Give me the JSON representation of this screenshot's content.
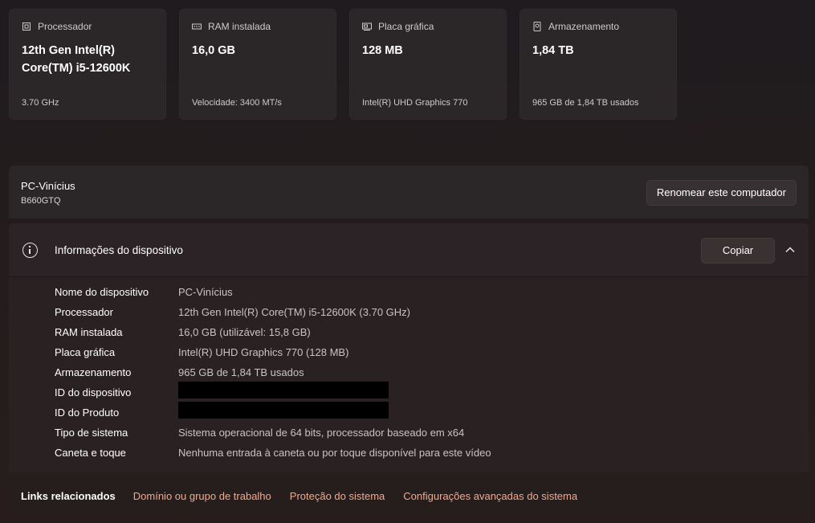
{
  "cards": [
    {
      "label": "Processador",
      "icon": "processor-icon",
      "value": "12th Gen Intel(R) Core(TM) i5-12600K",
      "sub": "3.70 GHz"
    },
    {
      "label": "RAM instalada",
      "icon": "ram-icon",
      "value": "16,0 GB",
      "sub": "Velocidade: 3400 MT/s"
    },
    {
      "label": "Placa gráfica",
      "icon": "graphics-card-icon",
      "value": "128 MB",
      "sub": "Intel(R) UHD Graphics 770"
    },
    {
      "label": "Armazenamento",
      "icon": "storage-icon",
      "value": "1,84 TB",
      "sub": "965 GB de 1,84 TB usados"
    }
  ],
  "pc": {
    "name": "PC-Vinícius",
    "model": "B660GTQ",
    "rename_label": "Renomear este computador"
  },
  "device_info": {
    "title": "Informações do dispositivo",
    "copy_label": "Copiar",
    "rows": [
      {
        "key": "Nome do dispositivo",
        "value": "PC-Vinícius"
      },
      {
        "key": "Processador",
        "value": "12th Gen Intel(R) Core(TM) i5-12600K (3.70 GHz)"
      },
      {
        "key": "RAM instalada",
        "value": "16,0 GB (utilizável: 15,8 GB)"
      },
      {
        "key": "Placa gráfica",
        "value": "Intel(R) UHD Graphics 770 (128 MB)"
      },
      {
        "key": "Armazenamento",
        "value": "965 GB de 1,84 TB usados"
      },
      {
        "key": "ID do dispositivo",
        "value": ""
      },
      {
        "key": "ID do Produto",
        "value": ""
      },
      {
        "key": "Tipo de sistema",
        "value": "Sistema operacional de 64 bits, processador baseado em x64"
      },
      {
        "key": "Caneta e toque",
        "value": "Nenhuma entrada à caneta ou por toque disponível para este vídeo"
      }
    ]
  },
  "related_links": {
    "title": "Links relacionados",
    "links": [
      "Domínio ou grupo de trabalho",
      "Proteção do sistema",
      "Configurações avançadas do sistema"
    ]
  },
  "colors": {
    "link": "#f3a98d",
    "card_bg": "#2b2628"
  }
}
